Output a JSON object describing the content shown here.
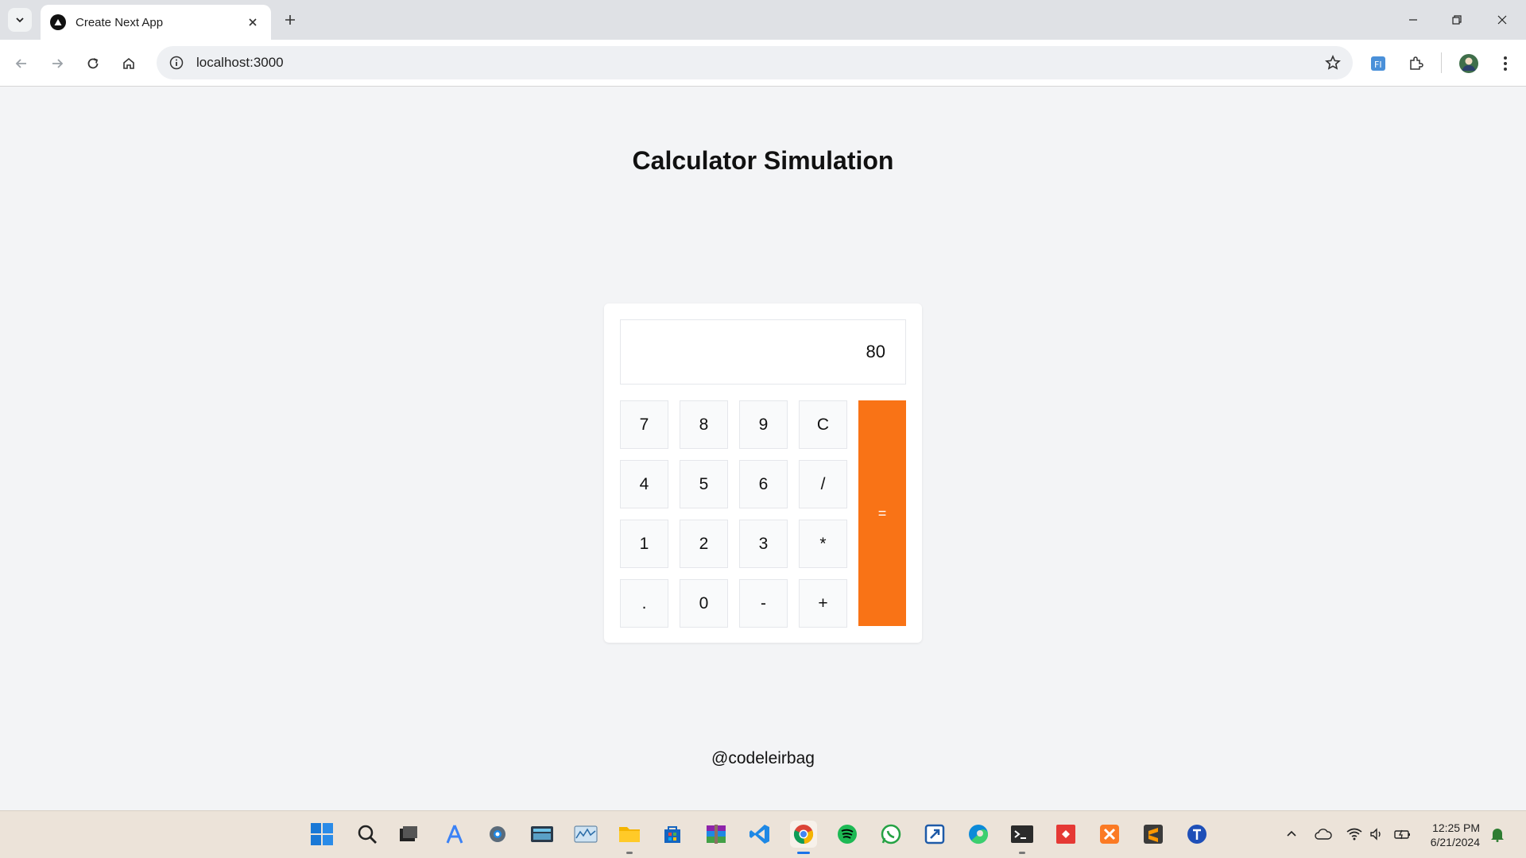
{
  "browser": {
    "tab_title": "Create Next App",
    "url": "localhost:3000"
  },
  "page": {
    "title": "Calculator Simulation",
    "display_value": "80",
    "keys": [
      [
        "7",
        "8",
        "9",
        "C"
      ],
      [
        "4",
        "5",
        "6",
        "/"
      ],
      [
        "1",
        "2",
        "3",
        "*"
      ],
      [
        ".",
        "0",
        "-",
        "+"
      ]
    ],
    "equals_label": "=",
    "footer": "@codeleirbag",
    "accent_color": "#f97316"
  },
  "taskbar": {
    "apps": [
      "windows-start",
      "search",
      "task-view",
      "app-store",
      "settings",
      "keyboard",
      "monitor",
      "file-explorer",
      "microsoft-store",
      "winrar",
      "vscode",
      "chrome",
      "spotify",
      "whatsapp",
      "remote-desktop",
      "edge",
      "terminal",
      "git",
      "xampp",
      "sublime-text",
      "blue-app"
    ],
    "time": "12:25 PM",
    "date": "6/21/2024"
  }
}
